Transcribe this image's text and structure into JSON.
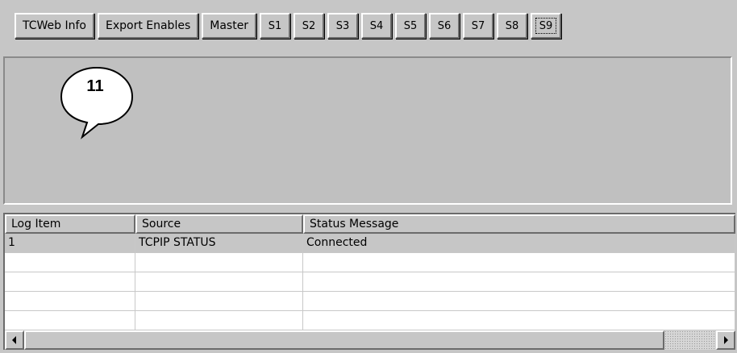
{
  "toolbar": {
    "buttons": [
      {
        "label": "TCWeb Info"
      },
      {
        "label": "Export Enables"
      },
      {
        "label": "Master"
      },
      {
        "label": "S1"
      },
      {
        "label": "S2"
      },
      {
        "label": "S3"
      },
      {
        "label": "S4"
      },
      {
        "label": "S5"
      },
      {
        "label": "S6"
      },
      {
        "label": "S7"
      },
      {
        "label": "S8"
      },
      {
        "label": "S9"
      }
    ],
    "selected": "S9"
  },
  "callout": {
    "number": "11"
  },
  "log": {
    "columns": [
      "Log Item",
      "Source",
      "Status Message"
    ],
    "rows": [
      {
        "item": "1",
        "source": "TCPIP STATUS",
        "message": "Connected"
      }
    ]
  },
  "scrollbar": {
    "left_arrow_icon": "arrow-left-icon",
    "right_arrow_icon": "arrow-right-icon"
  }
}
